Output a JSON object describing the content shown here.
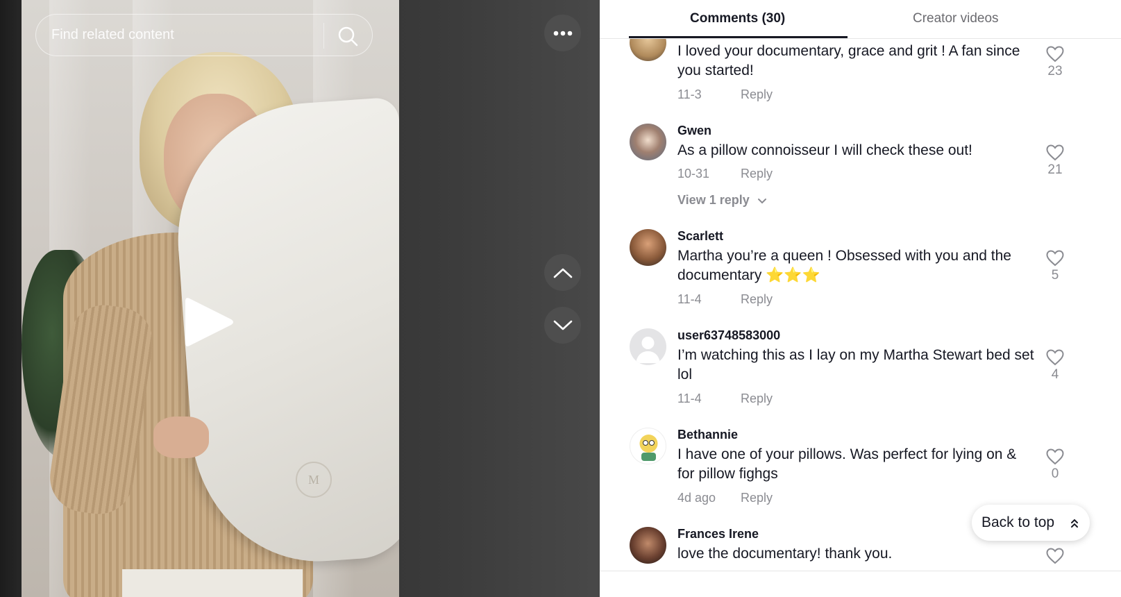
{
  "search": {
    "placeholder": "Find related content"
  },
  "tabs": [
    {
      "label": "Comments (30)",
      "active": true
    },
    {
      "label": "Creator videos",
      "active": false
    }
  ],
  "pillow_logo": "M",
  "comments": [
    {
      "author": "",
      "text": "I loved your documentary, grace and grit ! A fan since you started!",
      "date": "11-3",
      "reply_label": "Reply",
      "likes": "23",
      "avatar": "blonde-woman-avatar"
    },
    {
      "author": "Gwen",
      "text": "As a pillow connoisseur I will check these out!",
      "date": "10-31",
      "reply_label": "Reply",
      "likes": "21",
      "view_replies": "View 1 reply",
      "avatar": "woman-avatar"
    },
    {
      "author": "Scarlett",
      "text": "Martha you’re a queen ! Obsessed with you and the documentary ⭐⭐⭐",
      "date": "11-4",
      "reply_label": "Reply",
      "likes": "5",
      "avatar": "woman-avatar"
    },
    {
      "author": "user63748583000",
      "text": "I’m watching this as I lay on my Martha Stewart bed set lol",
      "date": "11-4",
      "reply_label": "Reply",
      "likes": "4",
      "avatar": "default-user-avatar"
    },
    {
      "author": "Bethannie",
      "text": "I have one of your pillows. Was perfect for lying on & for pillow fighgs",
      "date": "4d ago",
      "reply_label": "Reply",
      "likes": "0",
      "avatar": "cartoon-avatar"
    },
    {
      "author": "Frances Irene",
      "text": "love the documentary! thank you.",
      "date": "",
      "reply_label": "",
      "likes": "",
      "avatar": "woman-avatar"
    }
  ],
  "back_to_top": "Back to top",
  "colors": {
    "text_primary": "#161823",
    "text_secondary": "#8a8b91",
    "panel_bg": "#ffffff"
  }
}
